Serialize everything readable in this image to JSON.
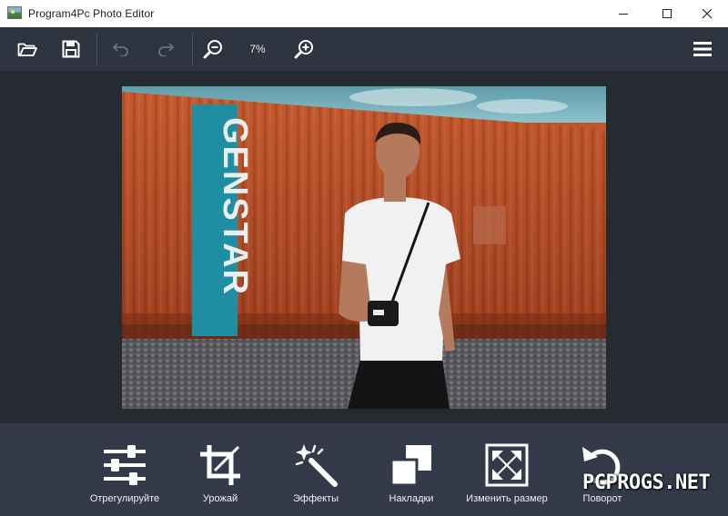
{
  "window": {
    "title": "Program4Pc Photo Editor",
    "icon": "photo-app-icon"
  },
  "toolbar": {
    "zoom_value": "7%",
    "buttons": [
      "open-folder-icon",
      "save-icon",
      "undo-icon",
      "redo-icon",
      "zoom-out-icon",
      "zoom-in-icon",
      "menu-icon"
    ]
  },
  "image": {
    "container_text": "GENSTAR"
  },
  "tools": [
    {
      "label": "Отрегулируйте",
      "icon": "adjust-sliders-icon"
    },
    {
      "label": "Урожай",
      "icon": "crop-icon"
    },
    {
      "label": "Эффекты",
      "icon": "magic-wand-icon"
    },
    {
      "label": "Накладки",
      "icon": "overlay-icon"
    },
    {
      "label": "Изменить размер",
      "icon": "resize-icon"
    },
    {
      "label": "Поворот",
      "icon": "rotate-icon"
    }
  ],
  "watermark": "PCPROGS.NET",
  "colors": {
    "toolbar": "#2f3441",
    "canvas": "#262a31",
    "bottom_panel": "#343a49",
    "icon": "#ffffff",
    "icon_disabled": "#6c7280"
  }
}
